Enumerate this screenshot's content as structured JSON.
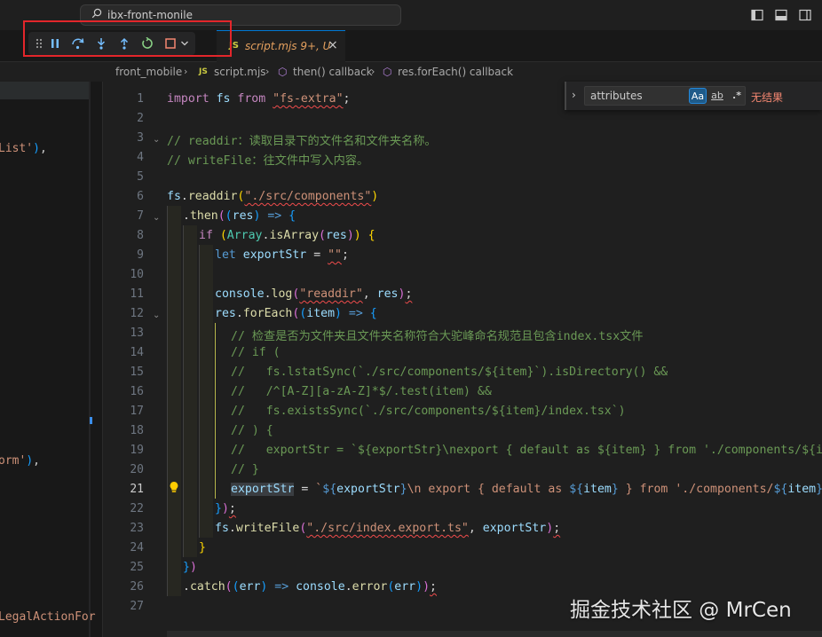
{
  "titlebar": {
    "search_text": "ibx-front-monile"
  },
  "tab": {
    "badge": "JS",
    "name": "script.mjs",
    "status": "9+, U",
    "close": "×"
  },
  "breadcrumb": [
    "front_mobile",
    "script.mjs",
    "then() callback",
    "res.forEach() callback"
  ],
  "breadcrumb_badge": "JS",
  "sidebar_fragments": [
    "List'),",
    "orm'),",
    "LegalActionFor"
  ],
  "find": {
    "value": "attributes",
    "match_case": "Aa",
    "whole_word": "ab",
    "regex": ".*",
    "no_results": "无结果"
  },
  "watermark": "掘金技术社区 @ MrCen",
  "line_numbers": [
    "1",
    "2",
    "3",
    "4",
    "5",
    "6",
    "7",
    "8",
    "9",
    "10",
    "11",
    "12",
    "13",
    "14",
    "15",
    "16",
    "17",
    "18",
    "19",
    "20",
    "21",
    "22",
    "23",
    "24",
    "25",
    "26",
    "27"
  ],
  "code": {
    "l1": [
      "import",
      " fs ",
      "from",
      " ",
      "\"fs-extra\"",
      ";"
    ],
    "l3": "// readdir：读取目录下的文件名和文件夹名称。",
    "l4": "// writeFile：往文件中写入内容。",
    "l6": [
      "fs",
      ".",
      "readdir",
      "(",
      "\"./src/components\"",
      ")"
    ],
    "l7": [
      ".",
      "then",
      "(",
      "(",
      "res",
      ")",
      " => ",
      "{"
    ],
    "l8": [
      "if",
      " ",
      "(",
      "Array",
      ".",
      "isArray",
      "(",
      "res",
      ")",
      ")",
      " ",
      "{"
    ],
    "l9": [
      "let",
      " ",
      "exportStr",
      " = ",
      "\"\"",
      ";"
    ],
    "l11": [
      "console",
      ".",
      "log",
      "(",
      "\"readdir\"",
      ", ",
      "res",
      ")",
      ";"
    ],
    "l12": [
      "res",
      ".",
      "forEach",
      "(",
      "(",
      "item",
      ")",
      " => ",
      "{"
    ],
    "l13": "// 检查是否为文件夹且文件夹名称符合大驼峰命名规范且包含index.tsx文件",
    "l14": "// if (",
    "l15": "//   fs.lstatSync(`./src/components/${item}`).isDirectory() &&",
    "l16": "//   /^[A-Z][a-zA-Z]*$/.test(item) &&",
    "l17": "//   fs.existsSync(`./src/components/${item}/index.tsx`)",
    "l18": "// ) {",
    "l19": "//   exportStr = `${exportStr}\\nexport { default as ${item} } from './components/${item}';`",
    "l20": "// }",
    "l21": [
      "exportStr",
      " = ",
      "`",
      "${",
      "exportStr",
      "}",
      "\\n export { default as ",
      "${",
      "item",
      "}",
      " } from './components/",
      "${",
      "item",
      "}",
      "';`",
      ";"
    ],
    "l22": [
      "}",
      ")",
      ";"
    ],
    "l23": [
      "fs",
      ".",
      "writeFile",
      "(",
      "\"./src/index.export.ts\"",
      ", ",
      "exportStr",
      ")",
      ";"
    ],
    "l24": "}",
    "l25": [
      "}",
      ")"
    ],
    "l26": [
      ".",
      "catch",
      "(",
      "(",
      "err",
      ")",
      " => ",
      "console",
      ".",
      "error",
      "(",
      "err",
      ")",
      ")",
      ";"
    ]
  },
  "colors": {
    "accent": "#0078d4",
    "highlight_box": "#e3262b",
    "keyword": "#c586c0",
    "string": "#ce9178",
    "comment": "#6a9955",
    "function": "#dcdcaa",
    "variable": "#9cdcfe"
  },
  "icons": {
    "debug": [
      "drag-grip-icon",
      "pause-icon",
      "step-over-icon",
      "step-into-icon",
      "step-out-icon",
      "restart-icon",
      "stop-icon",
      "chevron-down-icon"
    ],
    "layout": [
      "toggle-primary-sidebar-icon",
      "toggle-panel-icon",
      "toggle-secondary-sidebar-icon"
    ]
  }
}
